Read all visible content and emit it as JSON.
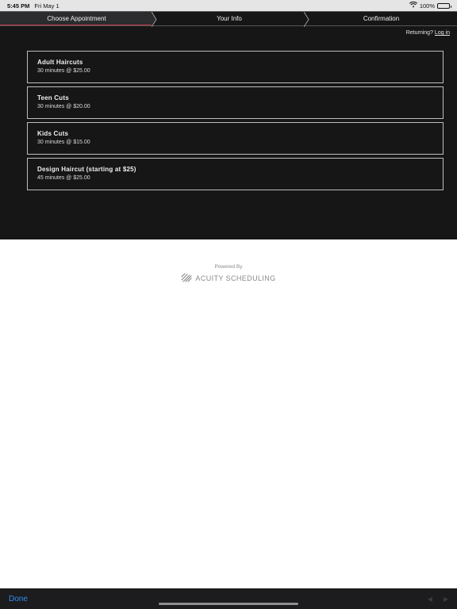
{
  "status_bar": {
    "time": "5:45 PM",
    "date": "Fri May 1",
    "battery": "100%",
    "wifi_icon": "wifi-icon",
    "battery_icon": "battery-icon"
  },
  "steps": [
    {
      "label": "Choose Appointment",
      "active": true
    },
    {
      "label": "Your Info",
      "active": false
    },
    {
      "label": "Confirmation",
      "active": false
    }
  ],
  "returning": {
    "text": "Returning?",
    "login": "Log in"
  },
  "services": [
    {
      "name": "Adult Haircuts",
      "detail": "30 minutes @ $25.00"
    },
    {
      "name": "Teen Cuts",
      "detail": "30 minutes @ $20.00"
    },
    {
      "name": "Kids Cuts",
      "detail": "30 minutes @ $15.00"
    },
    {
      "name": "Design Haircut (starting at $25)",
      "detail": "45 minutes @ $25.00"
    }
  ],
  "footer": {
    "powered_by": "Powered By",
    "brand": "ACUITY SCHEDULING"
  },
  "toolbar": {
    "done": "Done",
    "back_icon": "back-arrow-icon",
    "forward_icon": "forward-arrow-icon"
  },
  "colors": {
    "app_bg": "#161616",
    "active_step_bg": "#2c2c2e",
    "active_step_accent": "#c0394d",
    "done_blue": "#2f8cf4"
  }
}
